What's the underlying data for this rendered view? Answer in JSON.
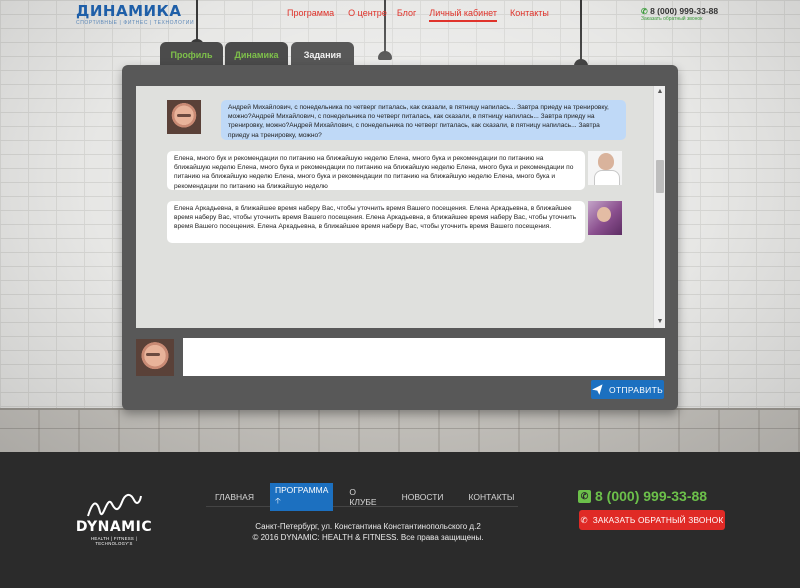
{
  "header": {
    "logo_title": "ДИНАМИКА",
    "logo_subtitle": "СПОРТИВНЫЕ | ФИТНЕС | ТЕХНОЛОГИИ",
    "nav": [
      "Программа",
      "О центре",
      "Блог",
      "Личный кабинет",
      "Контакты"
    ],
    "active_nav": "Личный кабинет",
    "phone": "8 (000) 999-33-88",
    "callback_link": "Заказать обратный звонок"
  },
  "tabs": [
    {
      "label": "Профиль",
      "active": false
    },
    {
      "label": "Динамика",
      "active": false
    },
    {
      "label": "Задания",
      "active": true
    }
  ],
  "chat": {
    "messages": [
      {
        "author": "self",
        "avatar": "man-avatar",
        "text": "Андрей Михайлович, с понедельника по четверг питалась, как сказали, в пятницу напилась... Завтра приеду на тренировку, можно?Андрей Михайлович, с понедельника по четверг питалась, как сказали, в пятницу напилась... Завтра приеду на тренировку, можно?Андрей Михайлович, с понедельника по четверг питалась, как сказали, в пятницу напилась... Завтра приеду на тренировку, можно?"
      },
      {
        "author": "trainer-doctor",
        "avatar": "doctor-avatar",
        "text": "Елена, много бук и рекомендации по питанию на ближайшую неделю Елена, много бука и рекомендации по питанию на ближайшую неделю Елена, много бука и рекомендации по питанию на ближайшую неделю Елена, много бука и рекомендации по питанию на ближайшую неделю Елена, много бука и рекомендации по питанию на ближайшую неделю Елена, много бука и рекомендации по питанию на ближайшую неделю"
      },
      {
        "author": "trainer-woman",
        "avatar": "woman-avatar",
        "text": "Елена Аркадьевна, в ближайшее время наберу Вас, чтобы уточнить время Вашего посещения. Елена Аркадьевна, в ближайшее время наберу Вас, чтобы уточнить время Вашего посещения. Елена Аркадьевна, в ближайшее время наберу Вас, чтобы уточнить время Вашего посещения. Елена Аркадьевна, в ближайшее время наберу Вас, чтобы уточнить время Вашего посещения."
      }
    ],
    "input_value": "",
    "send_label": "ОТПРАВИТЬ"
  },
  "footer": {
    "brand": "DYNAMIC",
    "tagline": "HEALTH | FITNESS | TECHNOLOGY'S",
    "nav": [
      "ГЛАВНАЯ",
      "ПРОГРАММА",
      "О КЛУБЕ",
      "НОВОСТИ",
      "КОНТАКТЫ"
    ],
    "active_nav": "ПРОГРАММА",
    "address_line1": "Санкт-Петербург, ул. Константина Константинопольского д.2",
    "address_line2": "© 2016 DYNAMIC: HEALTH & FITNESS. Все права защищены.",
    "phone": "8 (000) 999-33-88",
    "callback_button": "ЗАКАЗАТЬ ОБРАТНЫЙ ЗВОНОК"
  },
  "colors": {
    "accent_red": "#e0332b",
    "accent_blue": "#1c70c0",
    "accent_green": "#6cc04a",
    "panel": "#585858"
  }
}
